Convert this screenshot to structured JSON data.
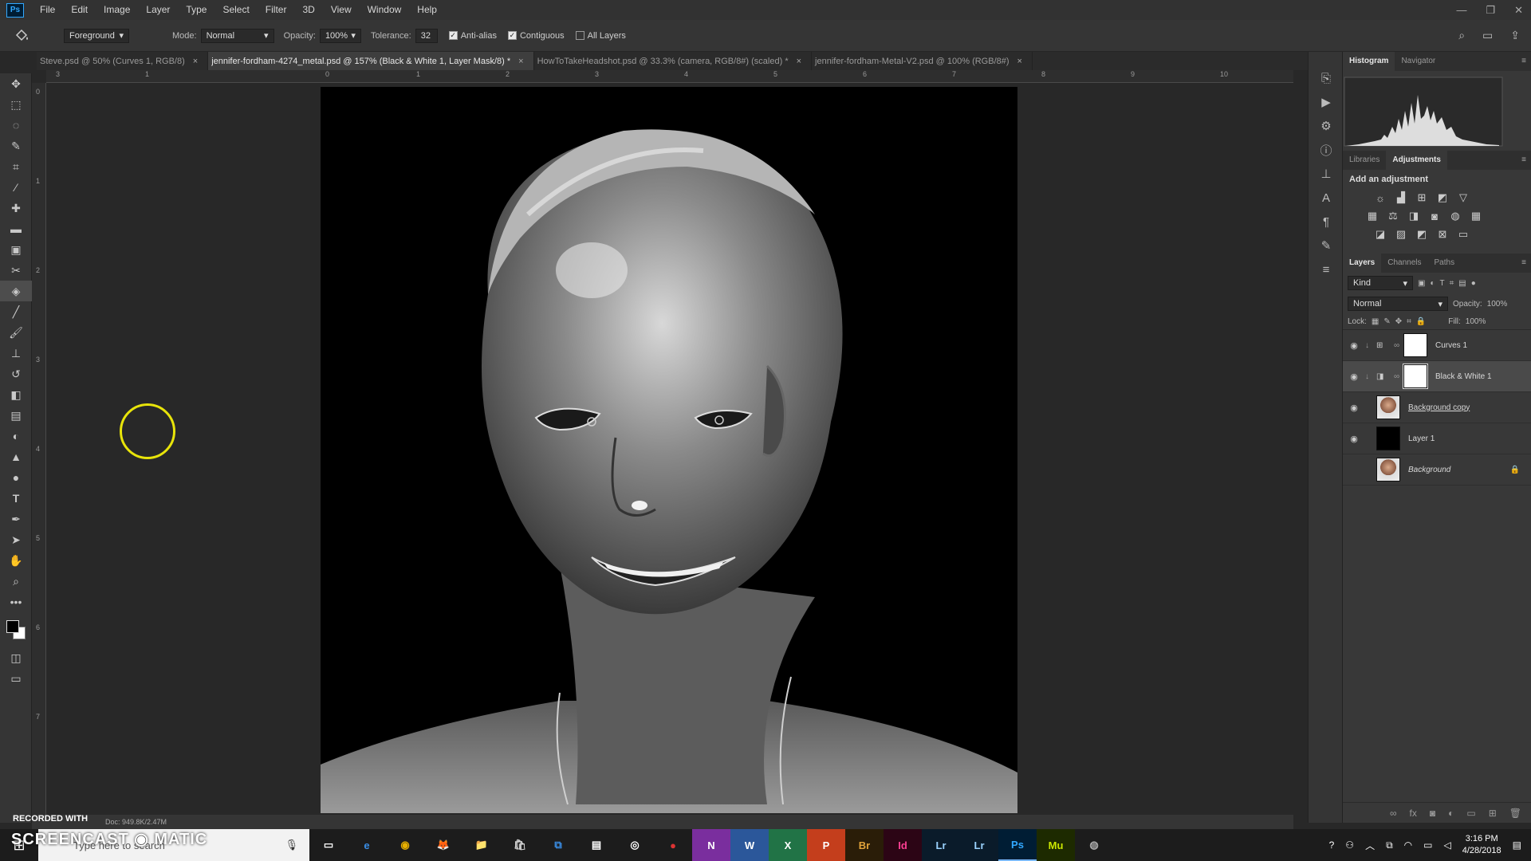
{
  "app": {
    "logo": "Ps"
  },
  "menu": [
    "File",
    "Edit",
    "Image",
    "Layer",
    "Type",
    "Select",
    "Filter",
    "3D",
    "View",
    "Window",
    "Help"
  ],
  "window_controls": [
    "—",
    "❐",
    "✕"
  ],
  "options": {
    "fill_source": "Foreground",
    "mode_label": "Mode:",
    "mode_value": "Normal",
    "opacity_label": "Opacity:",
    "opacity_value": "100%",
    "tolerance_label": "Tolerance:",
    "tolerance_value": "32",
    "anti_alias": "Anti-alias",
    "contiguous": "Contiguous",
    "all_layers": "All Layers"
  },
  "tabs": [
    {
      "label": "Steve.psd @ 50% (Curves 1, RGB/8)",
      "active": false
    },
    {
      "label": "jennifer-fordham-4274_metal.psd @ 157% (Black & White 1, Layer Mask/8) *",
      "active": true
    },
    {
      "label": "HowToTakeHeadshot.psd @ 33.3% (camera, RGB/8#) (scaled) *",
      "active": false
    },
    {
      "label": "jennifer-fordham-Metal-V2.psd @ 100% (RGB/8#)",
      "active": false
    }
  ],
  "tab_close": "×",
  "ruler_top": [
    "3",
    "1",
    "0",
    "1",
    "2",
    "3",
    "4",
    "5",
    "6",
    "7",
    "8",
    "9",
    "10"
  ],
  "ruler_left": [
    "0",
    "1",
    "2",
    "3",
    "4",
    "5",
    "6",
    "7"
  ],
  "tools": [
    "move-icon",
    "marquee-icon",
    "lasso-icon",
    "quick-select-icon",
    "crop-icon",
    "eyedropper-icon",
    "healing-icon",
    "ruler-icon",
    "frame-icon",
    "scissors-icon",
    "paint-bucket-icon",
    "line-icon",
    "brush-icon",
    "stamp-icon",
    "history-brush-icon",
    "eraser-icon",
    "gradient-icon",
    "dodge-icon",
    "sharpen-icon",
    "blur-icon",
    "type-icon",
    "pen-icon",
    "path-select-icon",
    "hand-icon",
    "zoom-icon",
    "more-icon"
  ],
  "status": {
    "doc": "Doc: 949.8K/2.47M",
    "recorded": "RECORDED WITH"
  },
  "panels": {
    "top_tabs": [
      "Histogram",
      "Navigator"
    ],
    "mid_tabs": [
      "Libraries",
      "Adjustments"
    ],
    "adjustments_title": "Add an adjustment",
    "layers_tabs": [
      "Layers",
      "Channels",
      "Paths"
    ],
    "kind": "Kind",
    "blend_mode": "Normal",
    "opacity_label": "Opacity:",
    "opacity_value": "100%",
    "lock_label": "Lock:",
    "fill_label": "Fill:",
    "fill_value": "100%",
    "layers": [
      {
        "name": "Curves 1",
        "thumb": "white",
        "selected": false
      },
      {
        "name": "Black & White 1",
        "thumb": "white",
        "selected": true
      },
      {
        "name": "Background copy",
        "thumb": "photo",
        "selected": false
      },
      {
        "name": "Layer 1",
        "thumb": "black",
        "selected": false
      },
      {
        "name": "Background",
        "thumb": "photo",
        "selected": false
      }
    ]
  },
  "taskbar": {
    "search_placeholder": "Type here to search",
    "apps": [
      "e",
      "◉",
      "🦊",
      "📁",
      "🛍",
      "⧉",
      "▤",
      "◎",
      "●",
      "N",
      "W",
      "X",
      "P",
      "Br",
      "Id",
      "Lr",
      "Lr",
      "Ps",
      "Mu",
      "◍"
    ],
    "time": "3:16 PM",
    "date": "4/28/2018",
    "screencast": "SCREENCAST",
    "matic": "MATIC"
  },
  "colors": {
    "accent": "#31a8ff",
    "cursor_ring": "#e8e40a"
  }
}
